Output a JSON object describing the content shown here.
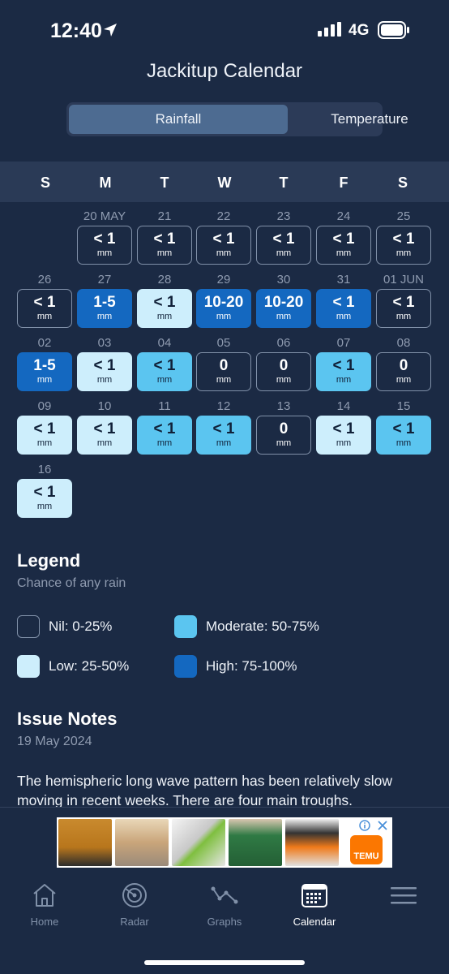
{
  "status": {
    "time": "12:40",
    "network": "4G"
  },
  "header": {
    "title": "Jackitup Calendar"
  },
  "tabs": {
    "rainfall": "Rainfall",
    "temperature": "Temperature"
  },
  "weekdays": [
    "S",
    "M",
    "T",
    "W",
    "T",
    "F",
    "S"
  ],
  "colors": {
    "nil": "#1b2a44",
    "low": "#cdeefc",
    "moderate": "#5bc5f0",
    "high": "#1468c0"
  },
  "calendar": {
    "unit": "mm",
    "days": [
      {
        "label": "20 MAY",
        "value": "< 1",
        "category": "nil"
      },
      {
        "label": "21",
        "value": "< 1",
        "category": "nil"
      },
      {
        "label": "22",
        "value": "< 1",
        "category": "nil"
      },
      {
        "label": "23",
        "value": "< 1",
        "category": "nil"
      },
      {
        "label": "24",
        "value": "< 1",
        "category": "nil"
      },
      {
        "label": "25",
        "value": "< 1",
        "category": "nil"
      },
      {
        "label": "26",
        "value": "< 1",
        "category": "nil"
      },
      {
        "label": "27",
        "value": "1-5",
        "category": "high"
      },
      {
        "label": "28",
        "value": "< 1",
        "category": "low"
      },
      {
        "label": "29",
        "value": "10-20",
        "category": "high"
      },
      {
        "label": "30",
        "value": "10-20",
        "category": "high"
      },
      {
        "label": "31",
        "value": "< 1",
        "category": "high"
      },
      {
        "label": "01 JUN",
        "value": "< 1",
        "category": "nil"
      },
      {
        "label": "02",
        "value": "1-5",
        "category": "high"
      },
      {
        "label": "03",
        "value": "< 1",
        "category": "low"
      },
      {
        "label": "04",
        "value": "< 1",
        "category": "moderate"
      },
      {
        "label": "05",
        "value": "0",
        "category": "nil"
      },
      {
        "label": "06",
        "value": "0",
        "category": "nil"
      },
      {
        "label": "07",
        "value": "< 1",
        "category": "moderate"
      },
      {
        "label": "08",
        "value": "0",
        "category": "nil"
      },
      {
        "label": "09",
        "value": "< 1",
        "category": "low"
      },
      {
        "label": "10",
        "value": "< 1",
        "category": "low"
      },
      {
        "label": "11",
        "value": "< 1",
        "category": "moderate"
      },
      {
        "label": "12",
        "value": "< 1",
        "category": "moderate"
      },
      {
        "label": "13",
        "value": "0",
        "category": "nil"
      },
      {
        "label": "14",
        "value": "< 1",
        "category": "low"
      },
      {
        "label": "15",
        "value": "< 1",
        "category": "moderate"
      },
      {
        "label": "16",
        "value": "< 1",
        "category": "low"
      }
    ]
  },
  "legend": {
    "title": "Legend",
    "subtitle": "Chance of any rain",
    "items": {
      "nil": "Nil: 0-25%",
      "moderate": "Moderate: 50-75%",
      "low": "Low: 25-50%",
      "high": "High: 75-100%"
    }
  },
  "notes": {
    "title": "Issue Notes",
    "date": "19 May 2024",
    "body": "The hemispheric long wave pattern has been relatively slow moving in recent weeks. There are four main troughs."
  },
  "ad": {
    "brand": "TEMU"
  },
  "tabbar": [
    {
      "label": "Home",
      "icon": "home-icon"
    },
    {
      "label": "Radar",
      "icon": "radar-icon"
    },
    {
      "label": "Graphs",
      "icon": "graphs-icon"
    },
    {
      "label": "Calendar",
      "icon": "calendar-icon",
      "active": true
    },
    {
      "label": "",
      "icon": "menu-icon"
    }
  ]
}
